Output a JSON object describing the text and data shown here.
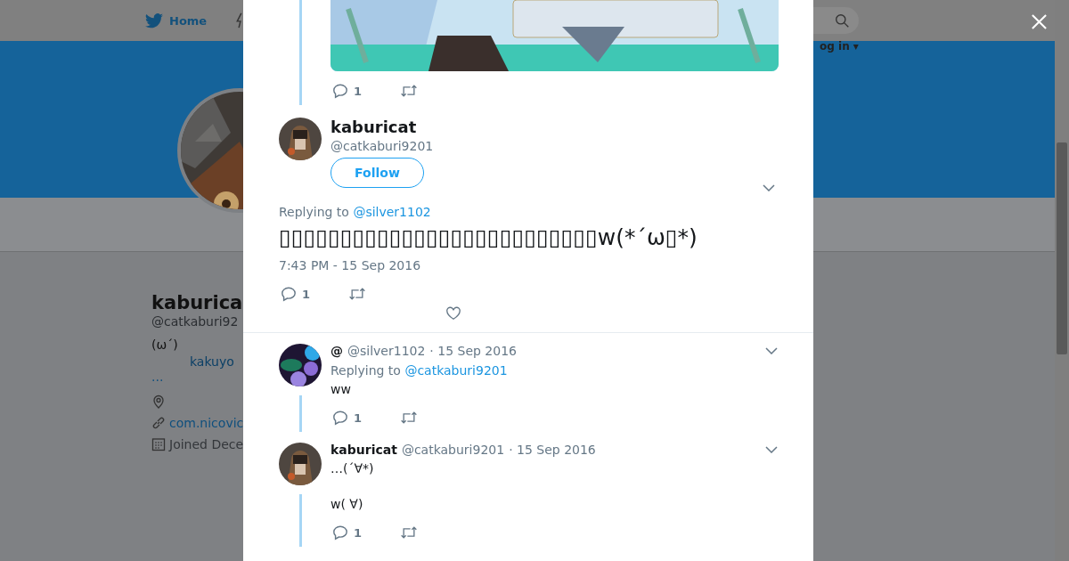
{
  "top_bar": {
    "home": "Home",
    "login": "og in ▾"
  },
  "profile": {
    "name": "kaburica",
    "handle": "@catkaburi92",
    "bio": "(ω´)",
    "bio_link": "kakuyo",
    "more": "...",
    "website": "com.nicovic",
    "joined": "Joined Dece"
  },
  "modal": {
    "previous_tweet": {
      "reply_count": "1"
    },
    "main_tweet": {
      "name": "kaburicat",
      "handle": "@catkaburi9201",
      "follow": "Follow",
      "replying_label": "Replying to",
      "replying_to": "@silver1102",
      "text": "▯▯▯▯▯▯▯▯▯▯▯▯▯▯▯▯▯▯▯▯▯▯▯▯▯▯w(*´ω▯*)",
      "time": "7:43 PM - 15 Sep 2016",
      "reply_count": "1"
    },
    "replies": [
      {
        "name": "@",
        "handle": "@silver1102",
        "date": "· 15 Sep 2016",
        "replying_label": "Replying to",
        "replying_to": "@catkaburi9201",
        "lines": [
          "ww"
        ],
        "reply_count": "1"
      },
      {
        "name": "kaburicat",
        "handle": "@catkaburi9201",
        "date": "· 15 Sep 2016",
        "lines": [
          "…(´∀*)",
          "w( ∀)"
        ],
        "reply_count": "1"
      }
    ]
  }
}
